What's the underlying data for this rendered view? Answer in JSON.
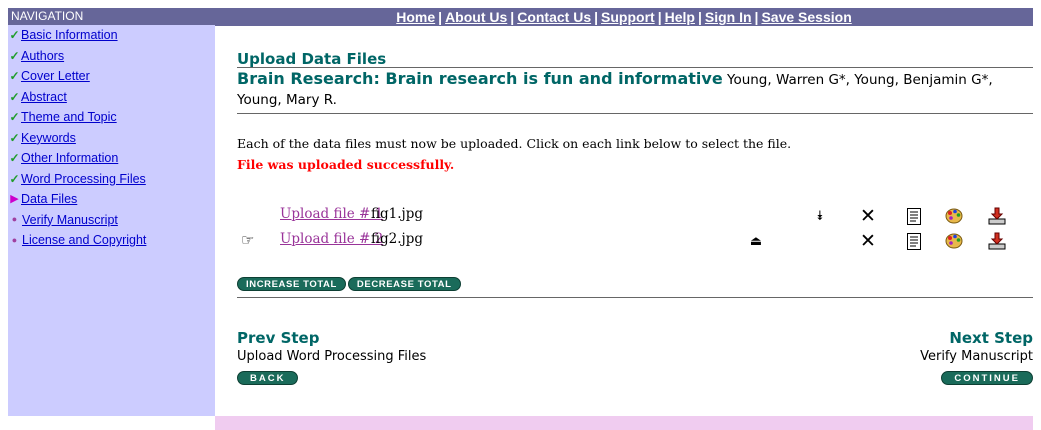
{
  "colors": {
    "sidebar_bg": "#ccccff",
    "bar_bg": "#666699",
    "heading_teal": "#006666",
    "status_red": "#ff0000",
    "pill_green": "#1a6b5a",
    "footer_pink": "#f0ccf0",
    "visited_link": "#993399"
  },
  "sidebar": {
    "header": "NAVIGATION",
    "items": [
      {
        "label": "Basic Information",
        "state": "done",
        "icon": "checkmark-icon"
      },
      {
        "label": "Authors",
        "state": "done",
        "icon": "checkmark-icon"
      },
      {
        "label": "Cover Letter",
        "state": "done",
        "icon": "checkmark-icon"
      },
      {
        "label": "Abstract",
        "state": "done",
        "icon": "checkmark-icon"
      },
      {
        "label": "Theme and Topic",
        "state": "done",
        "icon": "checkmark-icon"
      },
      {
        "label": "Keywords",
        "state": "done",
        "icon": "checkmark-icon"
      },
      {
        "label": "Other Information",
        "state": "done",
        "icon": "checkmark-icon"
      },
      {
        "label": "Word Processing Files",
        "state": "done",
        "icon": "checkmark-icon"
      },
      {
        "label": "Data Files",
        "state": "current",
        "icon": "current-step-arrow-icon"
      },
      {
        "label": "Verify Manuscript",
        "state": "pending",
        "icon": "bullet-icon"
      },
      {
        "label": "License and Copyright",
        "state": "pending",
        "icon": "bullet-icon"
      }
    ]
  },
  "topnav": {
    "links": [
      "Home",
      "About Us",
      "Contact Us",
      "Support",
      "Help",
      "Sign In",
      "Save Session"
    ],
    "separator": "|"
  },
  "main": {
    "page_title": "Upload Data Files",
    "manuscript_title": "Brain Research: Brain research is fun and informative",
    "authors": "Young, Warren G*, Young, Benjamin G*, Young, Mary R.",
    "instructions": "Each of the data files must now be uploaded. Click on each link below to select the file.",
    "status": "File was uploaded successfully.",
    "files": [
      {
        "link": "Upload file # 1",
        "filename": "fig1.jpg",
        "pointer": "",
        "move_icon": "move-down-icon",
        "move_glyph": "⯯"
      },
      {
        "link": "Upload file # 2",
        "filename": "fig2.jpg",
        "pointer": "☞",
        "move_icon": "move-up-icon",
        "move_glyph": "⏏"
      }
    ],
    "row_icons": [
      "delete-icon",
      "notes-icon",
      "palette-icon",
      "download-icon"
    ],
    "increase_total": "INCREASE TOTAL",
    "decrease_total": "DECREASE TOTAL",
    "prev_step_label": "Prev Step",
    "prev_step_desc": "Upload Word Processing Files",
    "back_button": "BACK",
    "next_step_label": "Next Step",
    "next_step_desc": "Verify Manuscript",
    "continue_button": "CONTINUE"
  }
}
